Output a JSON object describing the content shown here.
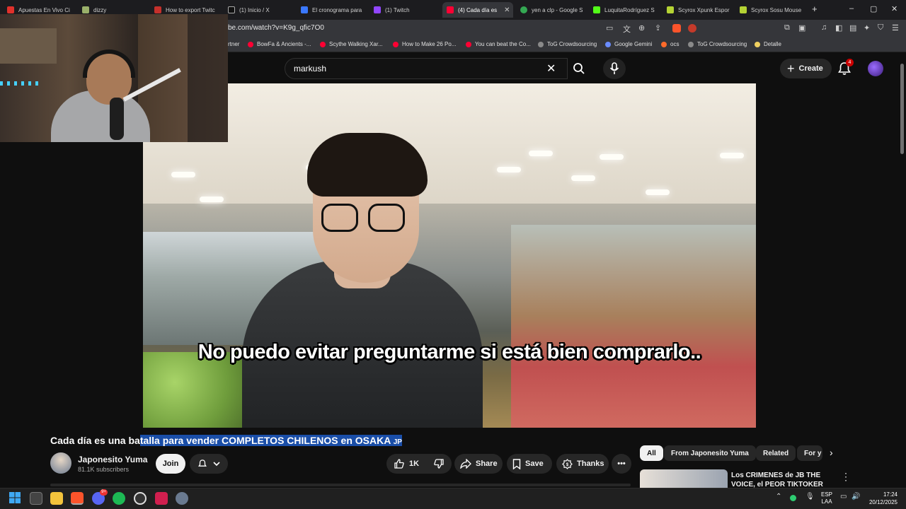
{
  "browser": {
    "tabs": [
      {
        "label": "Apuestas En Vivo Ci",
        "color": "#e0312b"
      },
      {
        "label": "dizzy",
        "color": "#9ab06a"
      },
      {
        "label": "How to export Twitc",
        "color": "#c4302b"
      },
      {
        "label": "(1) Inicio / X",
        "color": "#ffffff"
      },
      {
        "label": "El cronograma para",
        "color": "#3a78ff"
      },
      {
        "label": "(1) Twitch",
        "color": "#9146ff"
      },
      {
        "label": "(4) Cada día es",
        "color": "#ff0033"
      },
      {
        "label": "yen a clp - Google S",
        "color": "#34a853"
      },
      {
        "label": "LuquitaRodríguez S",
        "color": "#53fc18"
      },
      {
        "label": "Scyrox Xpunk Espor",
        "color": "#b5d334"
      },
      {
        "label": "Scyrox Sosu Mouse",
        "color": "#b5d334"
      }
    ],
    "new_tab": "+",
    "window_controls": [
      "–",
      "▢",
      "✕"
    ],
    "url": "be.com/watch?v=K9g_qfic7O0",
    "bookmarks": [
      {
        "label": "rtner",
        "color": "#888888"
      },
      {
        "label": "BowFa & Ancients -...",
        "color": "#ff0033"
      },
      {
        "label": "Scythe Walking Xar...",
        "color": "#ff0033"
      },
      {
        "label": "How to Make 26 Po...",
        "color": "#ff0033"
      },
      {
        "label": "You can beat the Co...",
        "color": "#ff0033"
      },
      {
        "label": "ToG Crowdsourcing",
        "color": "#8a8a8a"
      },
      {
        "label": "Google Gemini",
        "color": "#6a8cff"
      },
      {
        "label": "ocs",
        "color": "#ff6a2a"
      },
      {
        "label": "ToG Crowdsourcing",
        "color": "#8a8a8a"
      },
      {
        "label": "Detalle",
        "color": "#f0d060"
      }
    ]
  },
  "youtube": {
    "search_value": "markush",
    "create_label": "Create",
    "notifications_count": "4",
    "subtitle": "No puedo evitar preguntarme si está bien comprarlo..",
    "title_prefix": "Cada día es una ba",
    "title_selected": "talla para vender COMPLETOS CHILENOS en OSAKA ",
    "title_flag": "JP",
    "channel_name": "Japonesito Yuma",
    "channel_subs": "81.1K subscribers",
    "join_label": "Join",
    "like_count": "1K",
    "share_label": "Share",
    "save_label": "Save",
    "thanks_label": "Thanks",
    "chips": [
      "All",
      "From Japonesito Yuma",
      "Related",
      "For y"
    ],
    "rec_title": "Los CRIMENES de JB THE VOICE, el PEOR TIKTOKER"
  },
  "taskbar": {
    "lang_1": "ESP",
    "lang_2": "LAA",
    "time": "17:24",
    "date": "20/12/2025",
    "discord_badge": "9+"
  }
}
